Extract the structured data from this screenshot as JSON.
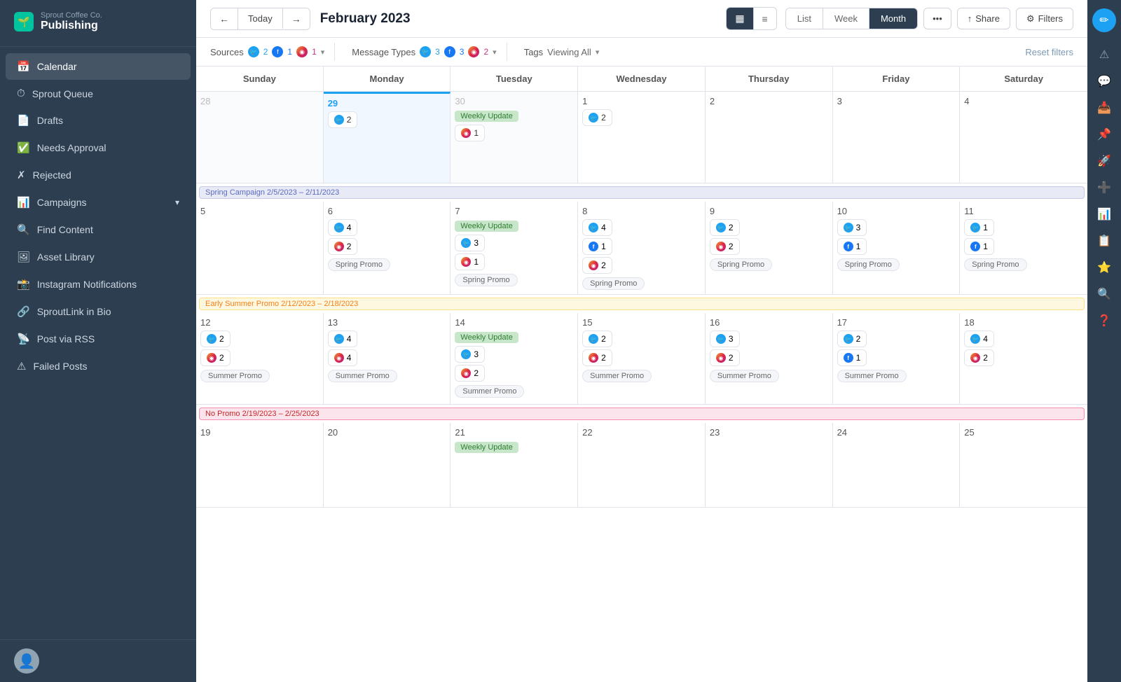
{
  "brand": {
    "company": "Sprout Coffee Co.",
    "app": "Publishing"
  },
  "sidebar": {
    "items": [
      {
        "id": "calendar",
        "label": "Calendar",
        "active": true
      },
      {
        "id": "sprout-queue",
        "label": "Sprout Queue",
        "active": false
      },
      {
        "id": "drafts",
        "label": "Drafts",
        "active": false
      },
      {
        "id": "needs-approval",
        "label": "Needs Approval",
        "active": false
      },
      {
        "id": "rejected",
        "label": "Rejected",
        "active": false
      },
      {
        "id": "campaigns",
        "label": "Campaigns",
        "active": false,
        "hasChevron": true
      },
      {
        "id": "find-content",
        "label": "Find Content",
        "active": false
      },
      {
        "id": "asset-library",
        "label": "Asset Library",
        "active": false
      },
      {
        "id": "instagram-notifications",
        "label": "Instagram Notifications",
        "active": false
      },
      {
        "id": "sproutlink-in-bio",
        "label": "SproutLink in Bio",
        "active": false
      },
      {
        "id": "post-via-rss",
        "label": "Post via RSS",
        "active": false
      },
      {
        "id": "failed-posts",
        "label": "Failed Posts",
        "active": false
      }
    ]
  },
  "toolbar": {
    "prev_label": "←",
    "next_label": "→",
    "today_label": "Today",
    "month_title": "February 2023",
    "grid_view_label": "▦",
    "list_view_label": "≡",
    "list_tab": "List",
    "week_tab": "Week",
    "month_tab": "Month",
    "more_label": "•••",
    "share_label": "Share",
    "filters_label": "Filters"
  },
  "filters": {
    "sources_label": "Sources",
    "sources_tw": "2",
    "sources_fb": "1",
    "sources_ig": "1",
    "message_types_label": "Message Types",
    "msg_tw": "3",
    "msg_fb": "3",
    "msg_ig": "2",
    "tags_label": "Tags",
    "tags_value": "Viewing All",
    "reset_label": "Reset filters"
  },
  "calendar": {
    "days": [
      "Sunday",
      "Monday",
      "Tuesday",
      "Wednesday",
      "Thursday",
      "Friday",
      "Saturday"
    ],
    "weeks": [
      {
        "campaign": null,
        "cells": [
          {
            "date": "28",
            "otherMonth": true,
            "posts": [],
            "promo": null
          },
          {
            "date": "29",
            "otherMonth": true,
            "posts": [
              {
                "icon": "tw",
                "count": "2"
              }
            ],
            "promo": null,
            "today": true
          },
          {
            "date": "30",
            "otherMonth": true,
            "weeklyUpdate": true,
            "posts": [
              {
                "icon": "ig",
                "count": "1"
              }
            ],
            "promo": null
          },
          {
            "date": "1",
            "posts": [
              {
                "icon": "tw",
                "count": "2"
              }
            ],
            "promo": null
          },
          {
            "date": "2",
            "posts": [],
            "promo": null
          },
          {
            "date": "3",
            "posts": [],
            "promo": null
          },
          {
            "date": "4",
            "posts": [],
            "promo": null
          }
        ]
      },
      {
        "campaign": {
          "label": "Spring Campaign 2/5/2023 – 2/11/2023",
          "type": "spring"
        },
        "cells": [
          {
            "date": "5",
            "posts": [],
            "promo": null
          },
          {
            "date": "6",
            "posts": [
              {
                "icon": "tw",
                "count": "4"
              },
              {
                "icon": "ig",
                "count": "2"
              }
            ],
            "promo": "Spring Promo"
          },
          {
            "date": "7",
            "weeklyUpdate": true,
            "posts": [
              {
                "icon": "tw",
                "count": "3"
              },
              {
                "icon": "ig",
                "count": "1"
              }
            ],
            "promo": "Spring Promo"
          },
          {
            "date": "8",
            "posts": [
              {
                "icon": "tw",
                "count": "4"
              },
              {
                "icon": "fb",
                "count": "1"
              },
              {
                "icon": "ig",
                "count": "2"
              }
            ],
            "promo": "Spring Promo"
          },
          {
            "date": "9",
            "posts": [
              {
                "icon": "tw",
                "count": "2"
              },
              {
                "icon": "ig",
                "count": "2"
              }
            ],
            "promo": "Spring Promo"
          },
          {
            "date": "10",
            "posts": [
              {
                "icon": "tw",
                "count": "3"
              },
              {
                "icon": "fb",
                "count": "1"
              }
            ],
            "promo": "Spring Promo"
          },
          {
            "date": "11",
            "posts": [
              {
                "icon": "tw",
                "count": "1"
              },
              {
                "icon": "fb",
                "count": "1"
              }
            ],
            "promo": "Spring Promo"
          }
        ]
      },
      {
        "campaign": {
          "label": "Early Summer Promo 2/12/2023 – 2/18/2023",
          "type": "summer"
        },
        "cells": [
          {
            "date": "12",
            "posts": [
              {
                "icon": "tw",
                "count": "2"
              },
              {
                "icon": "ig",
                "count": "2"
              }
            ],
            "promo": "Summer Promo"
          },
          {
            "date": "13",
            "posts": [
              {
                "icon": "tw",
                "count": "4"
              },
              {
                "icon": "ig",
                "count": "4"
              }
            ],
            "promo": "Summer Promo"
          },
          {
            "date": "14",
            "weeklyUpdate": true,
            "posts": [
              {
                "icon": "tw",
                "count": "3"
              },
              {
                "icon": "ig",
                "count": "2"
              }
            ],
            "promo": "Summer Promo"
          },
          {
            "date": "15",
            "posts": [
              {
                "icon": "tw",
                "count": "2"
              },
              {
                "icon": "ig",
                "count": "2"
              }
            ],
            "promo": "Summer Promo"
          },
          {
            "date": "16",
            "posts": [
              {
                "icon": "tw",
                "count": "3"
              },
              {
                "icon": "ig",
                "count": "2"
              }
            ],
            "promo": "Summer Promo"
          },
          {
            "date": "17",
            "posts": [
              {
                "icon": "tw",
                "count": "2"
              },
              {
                "icon": "fb",
                "count": "1"
              }
            ],
            "promo": "Summer Promo"
          },
          {
            "date": "18",
            "posts": [
              {
                "icon": "tw",
                "count": "4"
              },
              {
                "icon": "ig",
                "count": "2"
              }
            ],
            "promo": null
          }
        ]
      },
      {
        "campaign": {
          "label": "No Promo 2/19/2023 – 2/25/2023",
          "type": "nopromo"
        },
        "cells": [
          {
            "date": "19",
            "posts": [],
            "promo": null
          },
          {
            "date": "20",
            "posts": [],
            "promo": null
          },
          {
            "date": "21",
            "weeklyUpdate": true,
            "posts": [],
            "promo": null
          },
          {
            "date": "22",
            "posts": [],
            "promo": null
          },
          {
            "date": "23",
            "posts": [],
            "promo": null
          },
          {
            "date": "24",
            "posts": [],
            "promo": null
          },
          {
            "date": "25",
            "posts": [],
            "promo": null
          }
        ]
      }
    ]
  }
}
